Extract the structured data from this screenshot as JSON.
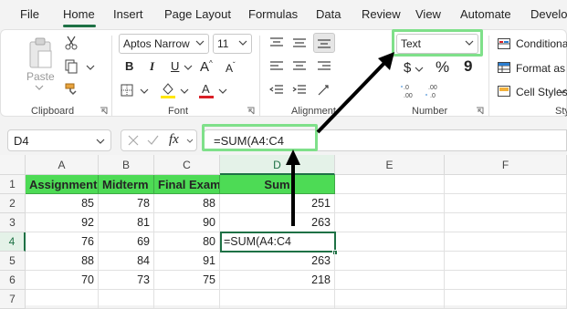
{
  "menu": {
    "tabs": [
      "File",
      "Home",
      "Insert",
      "Page Layout",
      "Formulas",
      "Data",
      "Review",
      "View",
      "Automate",
      "Develo"
    ],
    "active": "Home"
  },
  "ribbon": {
    "clipboard": {
      "paste_label": "Paste",
      "group_label": "Clipboard"
    },
    "font": {
      "font_name": "Aptos Narrow",
      "font_size": "11",
      "group_label": "Font"
    },
    "alignment": {
      "group_label": "Alignment"
    },
    "number": {
      "format": "Text",
      "currency": "$",
      "percent": "%",
      "comma": "9",
      "group_label": "Number"
    },
    "styles": {
      "conditional": "Conditional",
      "format_as_table": "Format as T",
      "cell_styles": "Cell Styles",
      "group_label": "Sty"
    }
  },
  "formula_bar": {
    "name_box": "D4",
    "fx": "fx",
    "formula": "=SUM(A4:C4"
  },
  "columns": [
    "A",
    "B",
    "C",
    "D",
    "E",
    "F"
  ],
  "rows": [
    "1",
    "2",
    "3",
    "4",
    "5",
    "6",
    "7"
  ],
  "table": {
    "headers": [
      "Assignment",
      "Midterm",
      "Final Exam",
      "Sum"
    ],
    "data": [
      [
        "85",
        "78",
        "88",
        "251"
      ],
      [
        "92",
        "81",
        "90",
        "263"
      ],
      [
        "76",
        "69",
        "80",
        "=SUM(A4:C4"
      ],
      [
        "88",
        "84",
        "91",
        "263"
      ],
      [
        "70",
        "73",
        "75",
        "218"
      ]
    ]
  },
  "colors": {
    "accent": "#1e7145",
    "header_fill": "#4ddb55",
    "highlight_box": "#7fe08a"
  }
}
